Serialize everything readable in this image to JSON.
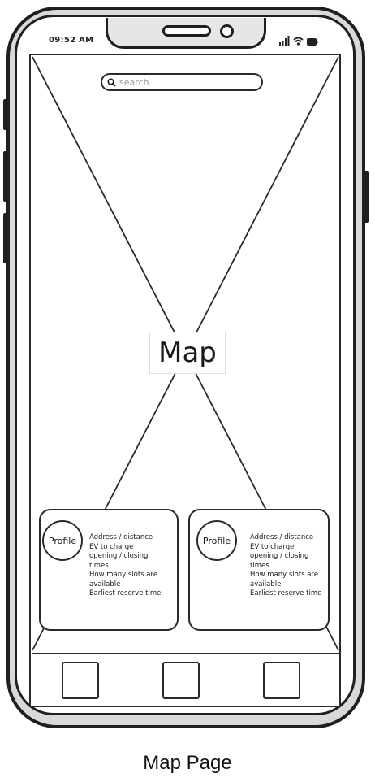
{
  "status_bar": {
    "time": "09:52 AM",
    "icons": [
      "signal-icon",
      "wifi-icon",
      "battery-icon"
    ]
  },
  "search": {
    "placeholder": "search",
    "icon": "search-icon"
  },
  "map": {
    "label": "Map"
  },
  "station_cards": [
    {
      "avatar_label": "Profile",
      "details": [
        "Address / distance",
        "EV to charge",
        "opening / closing",
        "times",
        "How many slots are",
        "available",
        "Earliest reserve time"
      ]
    },
    {
      "avatar_label": "Profile",
      "details": [
        "Address / distance",
        "EV to charge",
        "opening / closing",
        "times",
        "How many slots are",
        "available",
        "Earliest reserve time"
      ]
    }
  ],
  "bottom_nav": {
    "buttons": [
      "nav-button-1",
      "nav-button-2",
      "nav-button-3"
    ]
  },
  "caption": "Map Page",
  "colors": {
    "stroke": "#2a2a2a",
    "frame_fill": "#d9d9d9",
    "placeholder_text": "#9a9a9a"
  }
}
